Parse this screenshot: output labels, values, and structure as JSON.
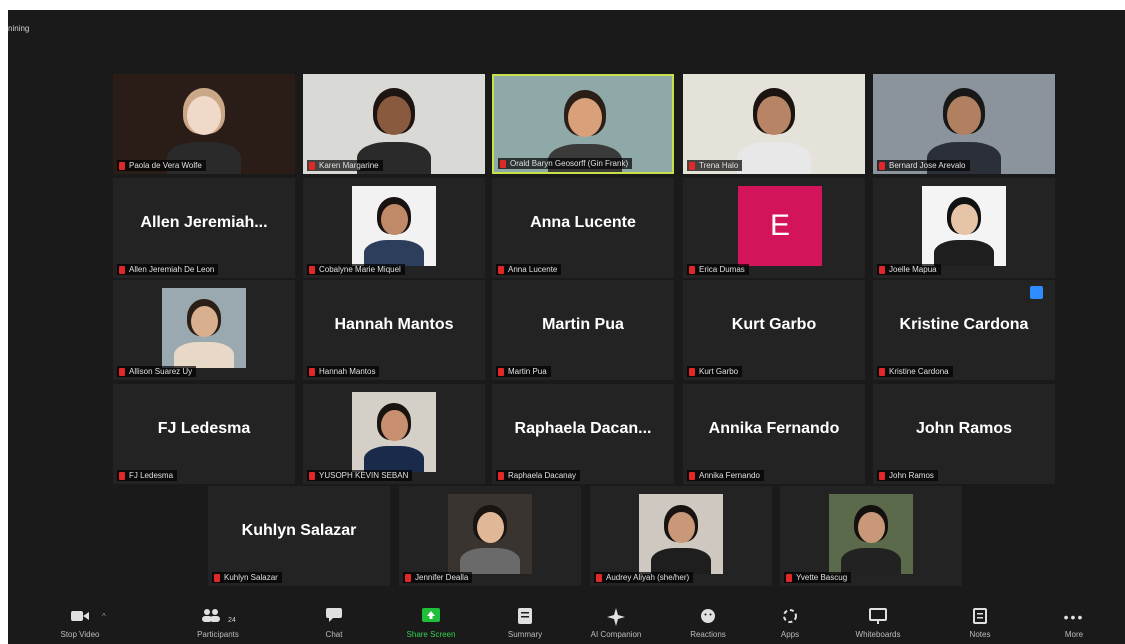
{
  "window": {
    "title_fragment": "nining"
  },
  "participants": [
    {
      "display": "",
      "label": "Paola de Vera Wolfe",
      "video": true,
      "bg": "#2a1d18",
      "skin": "#f0d9c8",
      "hair": "#caa887",
      "shirt": "#2a2a2a"
    },
    {
      "display": "",
      "label": "Karen Margarine",
      "video": true,
      "bg": "#d9d9d6",
      "skin": "#8a5a3f",
      "hair": "#1e1512",
      "shirt": "#2a2a2a"
    },
    {
      "display": "",
      "label": "Orald Baryn Geosorff (Gin Frank)",
      "video": true,
      "active": true,
      "bg": "#8fa8a8",
      "skin": "#d9a17a",
      "hair": "#2b1e16",
      "shirt": "#3a3a3a"
    },
    {
      "display": "",
      "label": "Trena Halo",
      "video": true,
      "bg": "#e5e2da",
      "skin": "#b88466",
      "hair": "#1c1410",
      "shirt": "#e8e8e8"
    },
    {
      "display": "",
      "label": "Bernard Jose Arevalo",
      "video": true,
      "bg": "#8b949c",
      "skin": "#b08060",
      "hair": "#181818",
      "shirt": "#2a2f38"
    },
    {
      "display": "Allen Jeremiah...",
      "label": "Allen Jeremiah De Leon",
      "video": false
    },
    {
      "display": "",
      "label": "Cobalyne Marie Miquel",
      "video": true,
      "bg": "#f2f2f2",
      "skin": "#c08a68",
      "hair": "#1a1210",
      "shirt": "#2d3e5c"
    },
    {
      "display": "Anna Lucente",
      "label": "Anna Lucente",
      "video": false
    },
    {
      "display": "",
      "label": "Erica Dumas",
      "video": false,
      "avatar": "E"
    },
    {
      "display": "",
      "label": "Joelle Mapua",
      "video": true,
      "bg": "#f4f4f4",
      "skin": "#e6c4a8",
      "hair": "#121212",
      "shirt": "#1e1e1e"
    },
    {
      "display": "",
      "label": "Allison Suarez Uy",
      "video": true,
      "bg": "#9aa8b0",
      "skin": "#d8b090",
      "hair": "#2a2018",
      "shirt": "#e8d8c8"
    },
    {
      "display": "Hannah Mantos",
      "label": "Hannah Mantos",
      "video": false
    },
    {
      "display": "Martin Pua",
      "label": "Martin Pua",
      "video": false
    },
    {
      "display": "Kurt Garbo",
      "label": "Kurt Garbo",
      "video": false
    },
    {
      "display": "Kristine Cardona",
      "label": "Kristine Cardona",
      "video": false,
      "badge": true
    },
    {
      "display": "FJ Ledesma",
      "label": "FJ Ledesma",
      "video": false
    },
    {
      "display": "",
      "label": "YUSOPH KEVIN SEBAN",
      "video": true,
      "bg": "#d4d0c8",
      "skin": "#c89070",
      "hair": "#1a1410",
      "shirt": "#1a2a4a"
    },
    {
      "display": "Raphaela Dacan...",
      "label": "Raphaela Dacanay",
      "video": false
    },
    {
      "display": "Annika Fernando",
      "label": "Annika Fernando",
      "video": false
    },
    {
      "display": "John Ramos",
      "label": "John Ramos",
      "video": false
    },
    {
      "display": "Kuhlyn Salazar",
      "label": "Kuhlyn Salazar",
      "video": false
    },
    {
      "display": "",
      "label": "Jennifer Dealla",
      "video": true,
      "bg": "#3a3430",
      "skin": "#e0b898",
      "hair": "#1a1410",
      "shirt": "#6a6a6a"
    },
    {
      "display": "",
      "label": "Audrey Aliyah (she/her)",
      "video": true,
      "bg": "#cfc8c0",
      "skin": "#c89878",
      "hair": "#181210",
      "shirt": "#1e1e1e"
    },
    {
      "display": "",
      "label": "Yvette Bascug",
      "video": true,
      "bg": "#5a6a4a",
      "skin": "#c89878",
      "hair": "#141010",
      "shirt": "#222222"
    }
  ],
  "toolbar": {
    "stop_video": "Stop Video",
    "participants": "Participants",
    "participants_count": "24",
    "chat": "Chat",
    "share_screen": "Share Screen",
    "summary": "Summary",
    "ai_companion": "AI Companion",
    "reactions": "Reactions",
    "apps": "Apps",
    "whiteboards": "Whiteboards",
    "notes": "Notes",
    "more": "More"
  },
  "icons": [
    "video-camera-icon",
    "participants-icon",
    "chat-icon",
    "share-screen-icon",
    "summary-icon",
    "ai-sparkle-icon",
    "reactions-icon",
    "apps-icon",
    "whiteboard-icon",
    "notes-icon",
    "more-icon",
    "mic-muted-icon"
  ],
  "colors": {
    "active_speaker": "#c8e04a",
    "share_green": "#1fbf3a",
    "muted_red": "#e02828",
    "avatar_pink": "#d4145a"
  }
}
